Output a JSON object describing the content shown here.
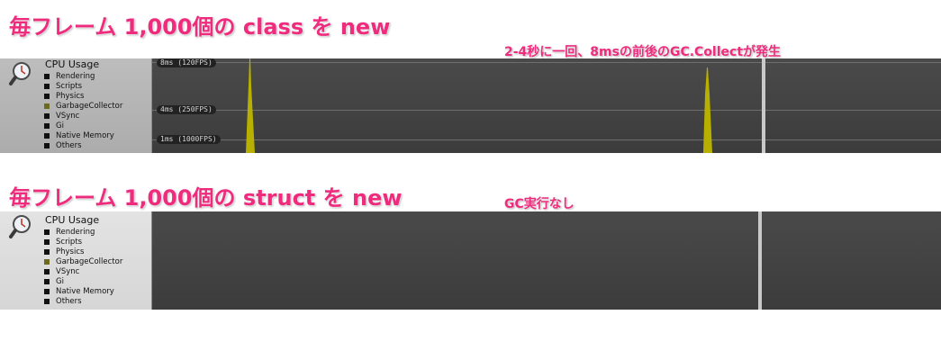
{
  "captions": {
    "class_caption": "毎フレーム 1,000個の class を new",
    "struct_caption": "毎フレーム 1,000個の struct を new",
    "class_note": "2-4秒に一回、8msの前後のGC.Collectが発生",
    "struct_note": "GC実行なし"
  },
  "profiler_top": {
    "title": "CPU Usage",
    "legend": [
      "Rendering",
      "Scripts",
      "Physics",
      "GarbageCollector",
      "VSync",
      "Gi",
      "Native Memory",
      "Others"
    ],
    "grid_labels": [
      "8ms (120FPS)",
      "4ms (250FPS)",
      "1ms (1000FPS)"
    ],
    "gc_spikes_ms": [
      8,
      6
    ],
    "sidebar_bg": "#b4b4b4"
  },
  "profiler_bottom": {
    "title": "CPU Usage",
    "legend": [
      "Rendering",
      "Scripts",
      "Physics",
      "GarbageCollector",
      "VSync",
      "Gi",
      "Native Memory",
      "Others"
    ],
    "sidebar_bg": "#dddddd"
  },
  "colors": {
    "caption": "#ee2b7d",
    "garbage_collector": "#6b6a1f",
    "spike": "#b8b000",
    "graph_bg": "#454545"
  },
  "icons": {
    "profiler_icon": "magnifier-icon"
  }
}
